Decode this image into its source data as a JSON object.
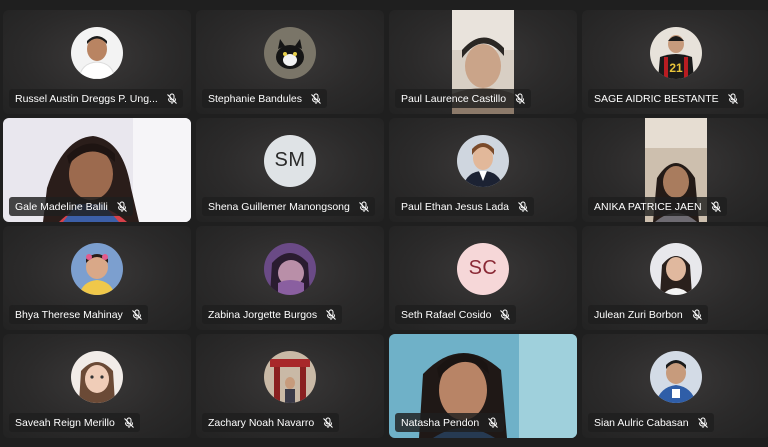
{
  "colors": {
    "background": "#1f1f1f",
    "tile": "#2b2a2a",
    "nameplate": "#1e1e1e",
    "initials_sm_bg": "#dfe3e6",
    "initials_sc_bg": "#f6d7d8"
  },
  "participants": [
    {
      "name": "Russel Austin Dreggs P. Ung...",
      "mic": "muted",
      "display": "avatar"
    },
    {
      "name": "Stephanie Bandules",
      "mic": "muted",
      "display": "avatar"
    },
    {
      "name": "Paul Laurence Castillo",
      "mic": "muted",
      "display": "video"
    },
    {
      "name": "SAGE AIDRIC BESTANTE",
      "mic": "muted",
      "display": "avatar"
    },
    {
      "name": "Gale Madeline Balili",
      "mic": "muted",
      "display": "video"
    },
    {
      "name": "Shena Guillemer Manongsong",
      "mic": "muted",
      "display": "initials",
      "initials": "SM"
    },
    {
      "name": "Paul Ethan Jesus Lada",
      "mic": "muted",
      "display": "avatar"
    },
    {
      "name": "ANIKA PATRICE JAEN",
      "mic": "muted",
      "display": "video"
    },
    {
      "name": "Bhya Therese Mahinay",
      "mic": "muted",
      "display": "avatar"
    },
    {
      "name": "Zabina Jorgette Burgos",
      "mic": "muted",
      "display": "avatar"
    },
    {
      "name": "Seth Rafael Cosido",
      "mic": "muted",
      "display": "initials",
      "initials": "SC"
    },
    {
      "name": "Julean Zuri Borbon",
      "mic": "muted",
      "display": "avatar"
    },
    {
      "name": "Saveah Reign Merillo",
      "mic": "muted",
      "display": "avatar"
    },
    {
      "name": "Zachary Noah Navarro",
      "mic": "muted",
      "display": "avatar"
    },
    {
      "name": "Natasha Pendon",
      "mic": "muted",
      "display": "video"
    },
    {
      "name": "Sian Aulric Cabasan",
      "mic": "muted",
      "display": "avatar"
    }
  ]
}
